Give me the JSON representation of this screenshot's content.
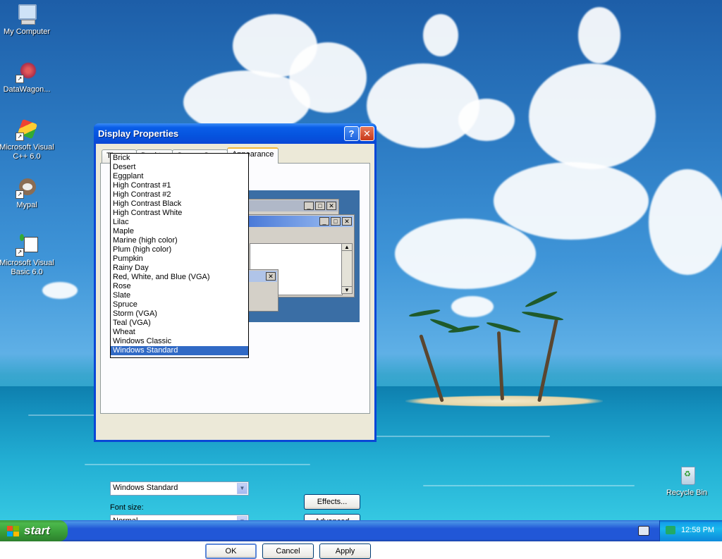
{
  "desktop": {
    "icons": [
      {
        "label": "My Computer"
      },
      {
        "label": "DataWagon..."
      },
      {
        "label": "Microsoft Visual C++ 6.0"
      },
      {
        "label": "Mypal"
      },
      {
        "label": "Microsoft Visual Basic 6.0"
      },
      {
        "label": "Recycle Bin"
      }
    ]
  },
  "window": {
    "title": "Display Properties",
    "help_label": "?",
    "close_label": "✕",
    "tabs": [
      {
        "label": "Themes"
      },
      {
        "label": "Desktop"
      },
      {
        "label": "Screen Saver"
      },
      {
        "label": "Appearance"
      }
    ],
    "scheme_dropdown": {
      "options": [
        "Brick",
        "Desert",
        "Eggplant",
        "High Contrast #1",
        "High Contrast #2",
        "High Contrast Black",
        "High Contrast White",
        "Lilac",
        "Maple",
        "Marine (high color)",
        "Plum (high color)",
        "Pumpkin",
        "Rainy Day",
        "Red, White, and Blue (VGA)",
        "Rose",
        "Slate",
        "Spruce",
        "Storm (VGA)",
        "Teal (VGA)",
        "Wheat",
        "Windows Classic",
        "Windows Standard"
      ],
      "selected": "Windows Standard"
    },
    "font_size_label": "Font size:",
    "font_size_value": "Normal",
    "effects_label": "Effects...",
    "advanced_label": "Advanced",
    "ok_label": "OK",
    "cancel_label": "Cancel",
    "apply_label": "Apply"
  },
  "taskbar": {
    "start_label": "start",
    "clock": "12:58 PM"
  }
}
